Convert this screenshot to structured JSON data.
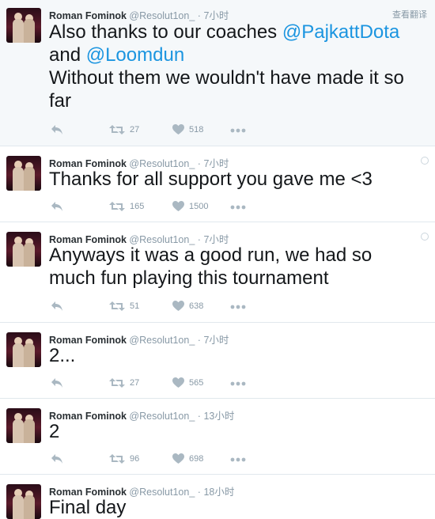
{
  "translate_label": "查看翻译",
  "tweets": [
    {
      "name": "Roman Fominok",
      "handle": "@Resolut1on_",
      "sep": "·",
      "time": "7小时",
      "line1_pre": "Also thanks to our coaches ",
      "mention1": "@PajkattDota",
      "line2_pre": "and ",
      "mention2": "@Loomdun",
      "line3": "Without them we wouldn't have made it so",
      "line4": "far",
      "retweets": "27",
      "likes": "518"
    },
    {
      "name": "Roman Fominok",
      "handle": "@Resolut1on_",
      "sep": "·",
      "time": "7小时",
      "text": "Thanks for all support you gave me <3",
      "retweets": "165",
      "likes": "1500"
    },
    {
      "name": "Roman Fominok",
      "handle": "@Resolut1on_",
      "sep": "·",
      "time": "7小时",
      "line1": "Anyways it was a good run, we had so",
      "line2": "much fun playing this tournament",
      "retweets": "51",
      "likes": "638"
    },
    {
      "name": "Roman Fominok",
      "handle": "@Resolut1on_",
      "sep": "·",
      "time": "7小时",
      "text": "2...",
      "retweets": "27",
      "likes": "565"
    },
    {
      "name": "Roman Fominok",
      "handle": "@Resolut1on_",
      "sep": "·",
      "time": "13小时",
      "text": "2",
      "retweets": "96",
      "likes": "698"
    },
    {
      "name": "Roman Fominok",
      "handle": "@Resolut1on_",
      "sep": "·",
      "time": "18小时",
      "text": "Final day"
    }
  ]
}
